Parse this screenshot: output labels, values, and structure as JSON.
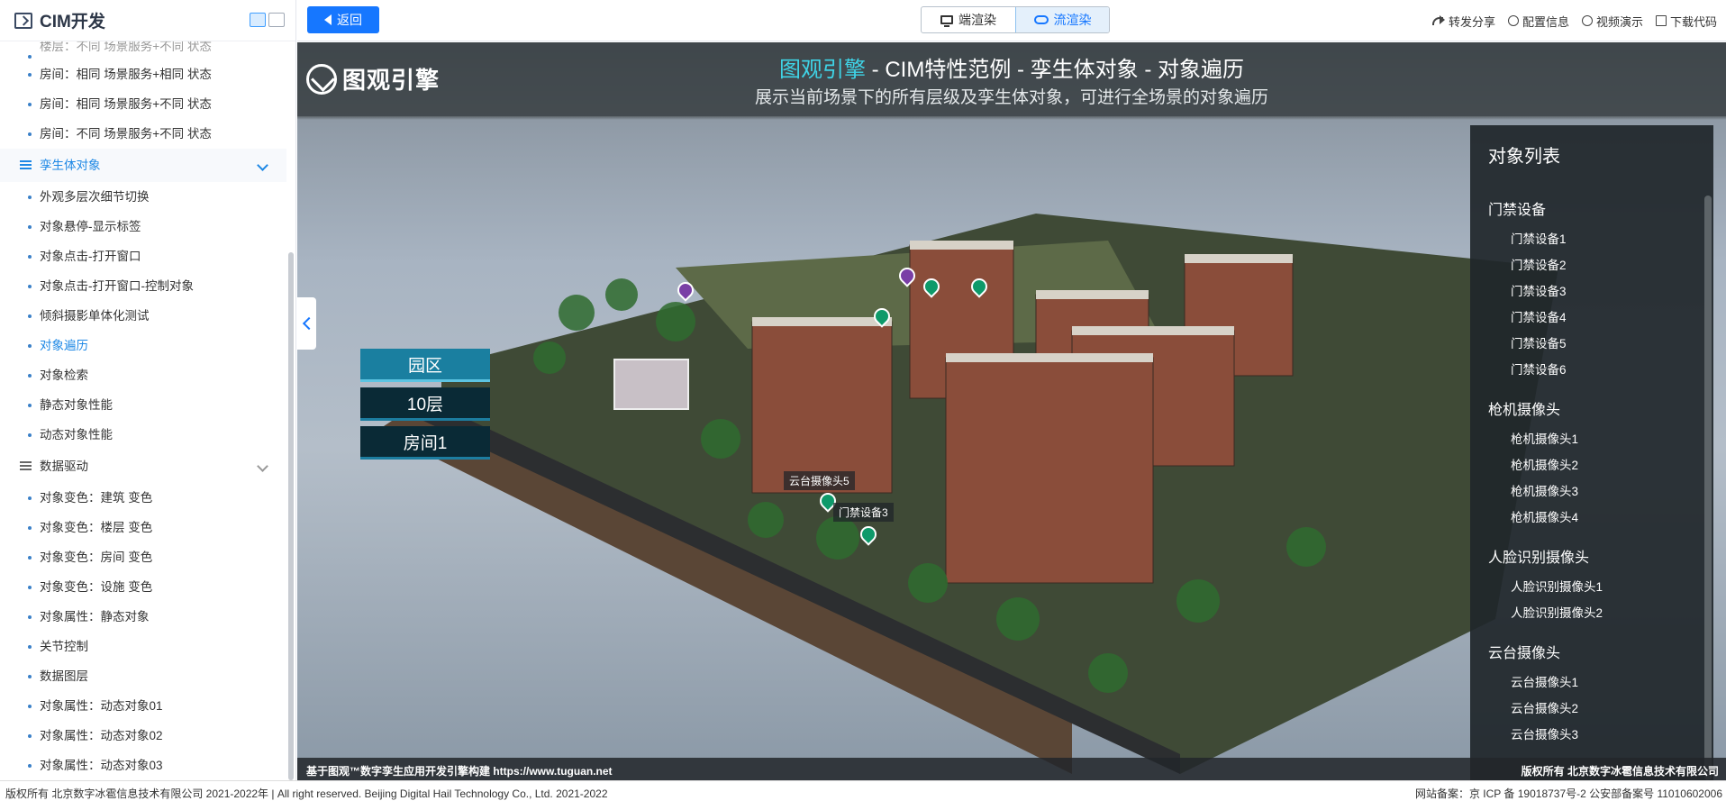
{
  "sidebar": {
    "title": "CIM开发",
    "partial_item": "楼层：不同 场景服务+不同 状态",
    "items_top": [
      "房间：相同 场景服务+相同 状态",
      "房间：相同 场景服务+不同 状态",
      "房间：不同 场景服务+不同 状态"
    ],
    "group_twin": "孪生体对象",
    "twin_items": [
      "外观多层次细节切换",
      "对象悬停-显示标签",
      "对象点击-打开窗口",
      "对象点击-打开窗口-控制对象",
      "倾斜摄影单体化测试",
      "对象遍历",
      "对象检索",
      "静态对象性能",
      "动态对象性能"
    ],
    "group_data": "数据驱动",
    "data_items": [
      "对象变色：建筑 变色",
      "对象变色：楼层 变色",
      "对象变色：房间 变色",
      "对象变色：设施 变色",
      "对象属性：静态对象",
      "关节控制",
      "数据图层",
      "对象属性：动态对象01",
      "对象属性：动态对象02",
      "对象属性：动态对象03"
    ]
  },
  "topbar": {
    "back_label": "返回",
    "render_client": "端渲染",
    "render_stream": "流渲染",
    "actions": [
      "转发分享",
      "配置信息",
      "视频演示",
      "下载代码"
    ]
  },
  "banner": {
    "brand": "图观引擎",
    "title_hl": "图观引擎",
    "title_rest": " - CIM特性范例 - 孪生体对象 - 对象遍历",
    "subtitle": "展示当前场景下的所有层级及孪生体对象，可进行全场景的对象遍历"
  },
  "levels": [
    "园区",
    "10层",
    "房间1"
  ],
  "scene_labels": {
    "ptz5": "云台摄像头5",
    "door3": "门禁设备3"
  },
  "object_panel": {
    "title": "对象列表",
    "groups": [
      {
        "name": "门禁设备",
        "items": [
          "门禁设备1",
          "门禁设备2",
          "门禁设备3",
          "门禁设备4",
          "门禁设备5",
          "门禁设备6"
        ]
      },
      {
        "name": "枪机摄像头",
        "items": [
          "枪机摄像头1",
          "枪机摄像头2",
          "枪机摄像头3",
          "枪机摄像头4"
        ]
      },
      {
        "name": "人脸识别摄像头",
        "items": [
          "人脸识别摄像头1",
          "人脸识别摄像头2"
        ]
      },
      {
        "name": "云台摄像头",
        "items": [
          "云台摄像头1",
          "云台摄像头2",
          "云台摄像头3"
        ]
      }
    ]
  },
  "viewport_footer": {
    "left": "基于图观™数字孪生应用开发引擎构建 https://www.tuguan.net",
    "right": "版权所有 北京数字冰雹信息技术有限公司"
  },
  "page_footer": {
    "left": "版权所有 北京数字冰雹信息技术有限公司 2021-2022年 | All right reserved. Beijing Digital Hail Technology Co., Ltd. 2021-2022",
    "right": "网站备案：京 ICP 备 19018737号-2 公安部备案号 11010602006"
  },
  "colors": {
    "accent": "#1677ff",
    "title_highlight": "#3fd3e6",
    "level_active": "#1a7fa0",
    "level_inactive": "#0a2a36"
  }
}
